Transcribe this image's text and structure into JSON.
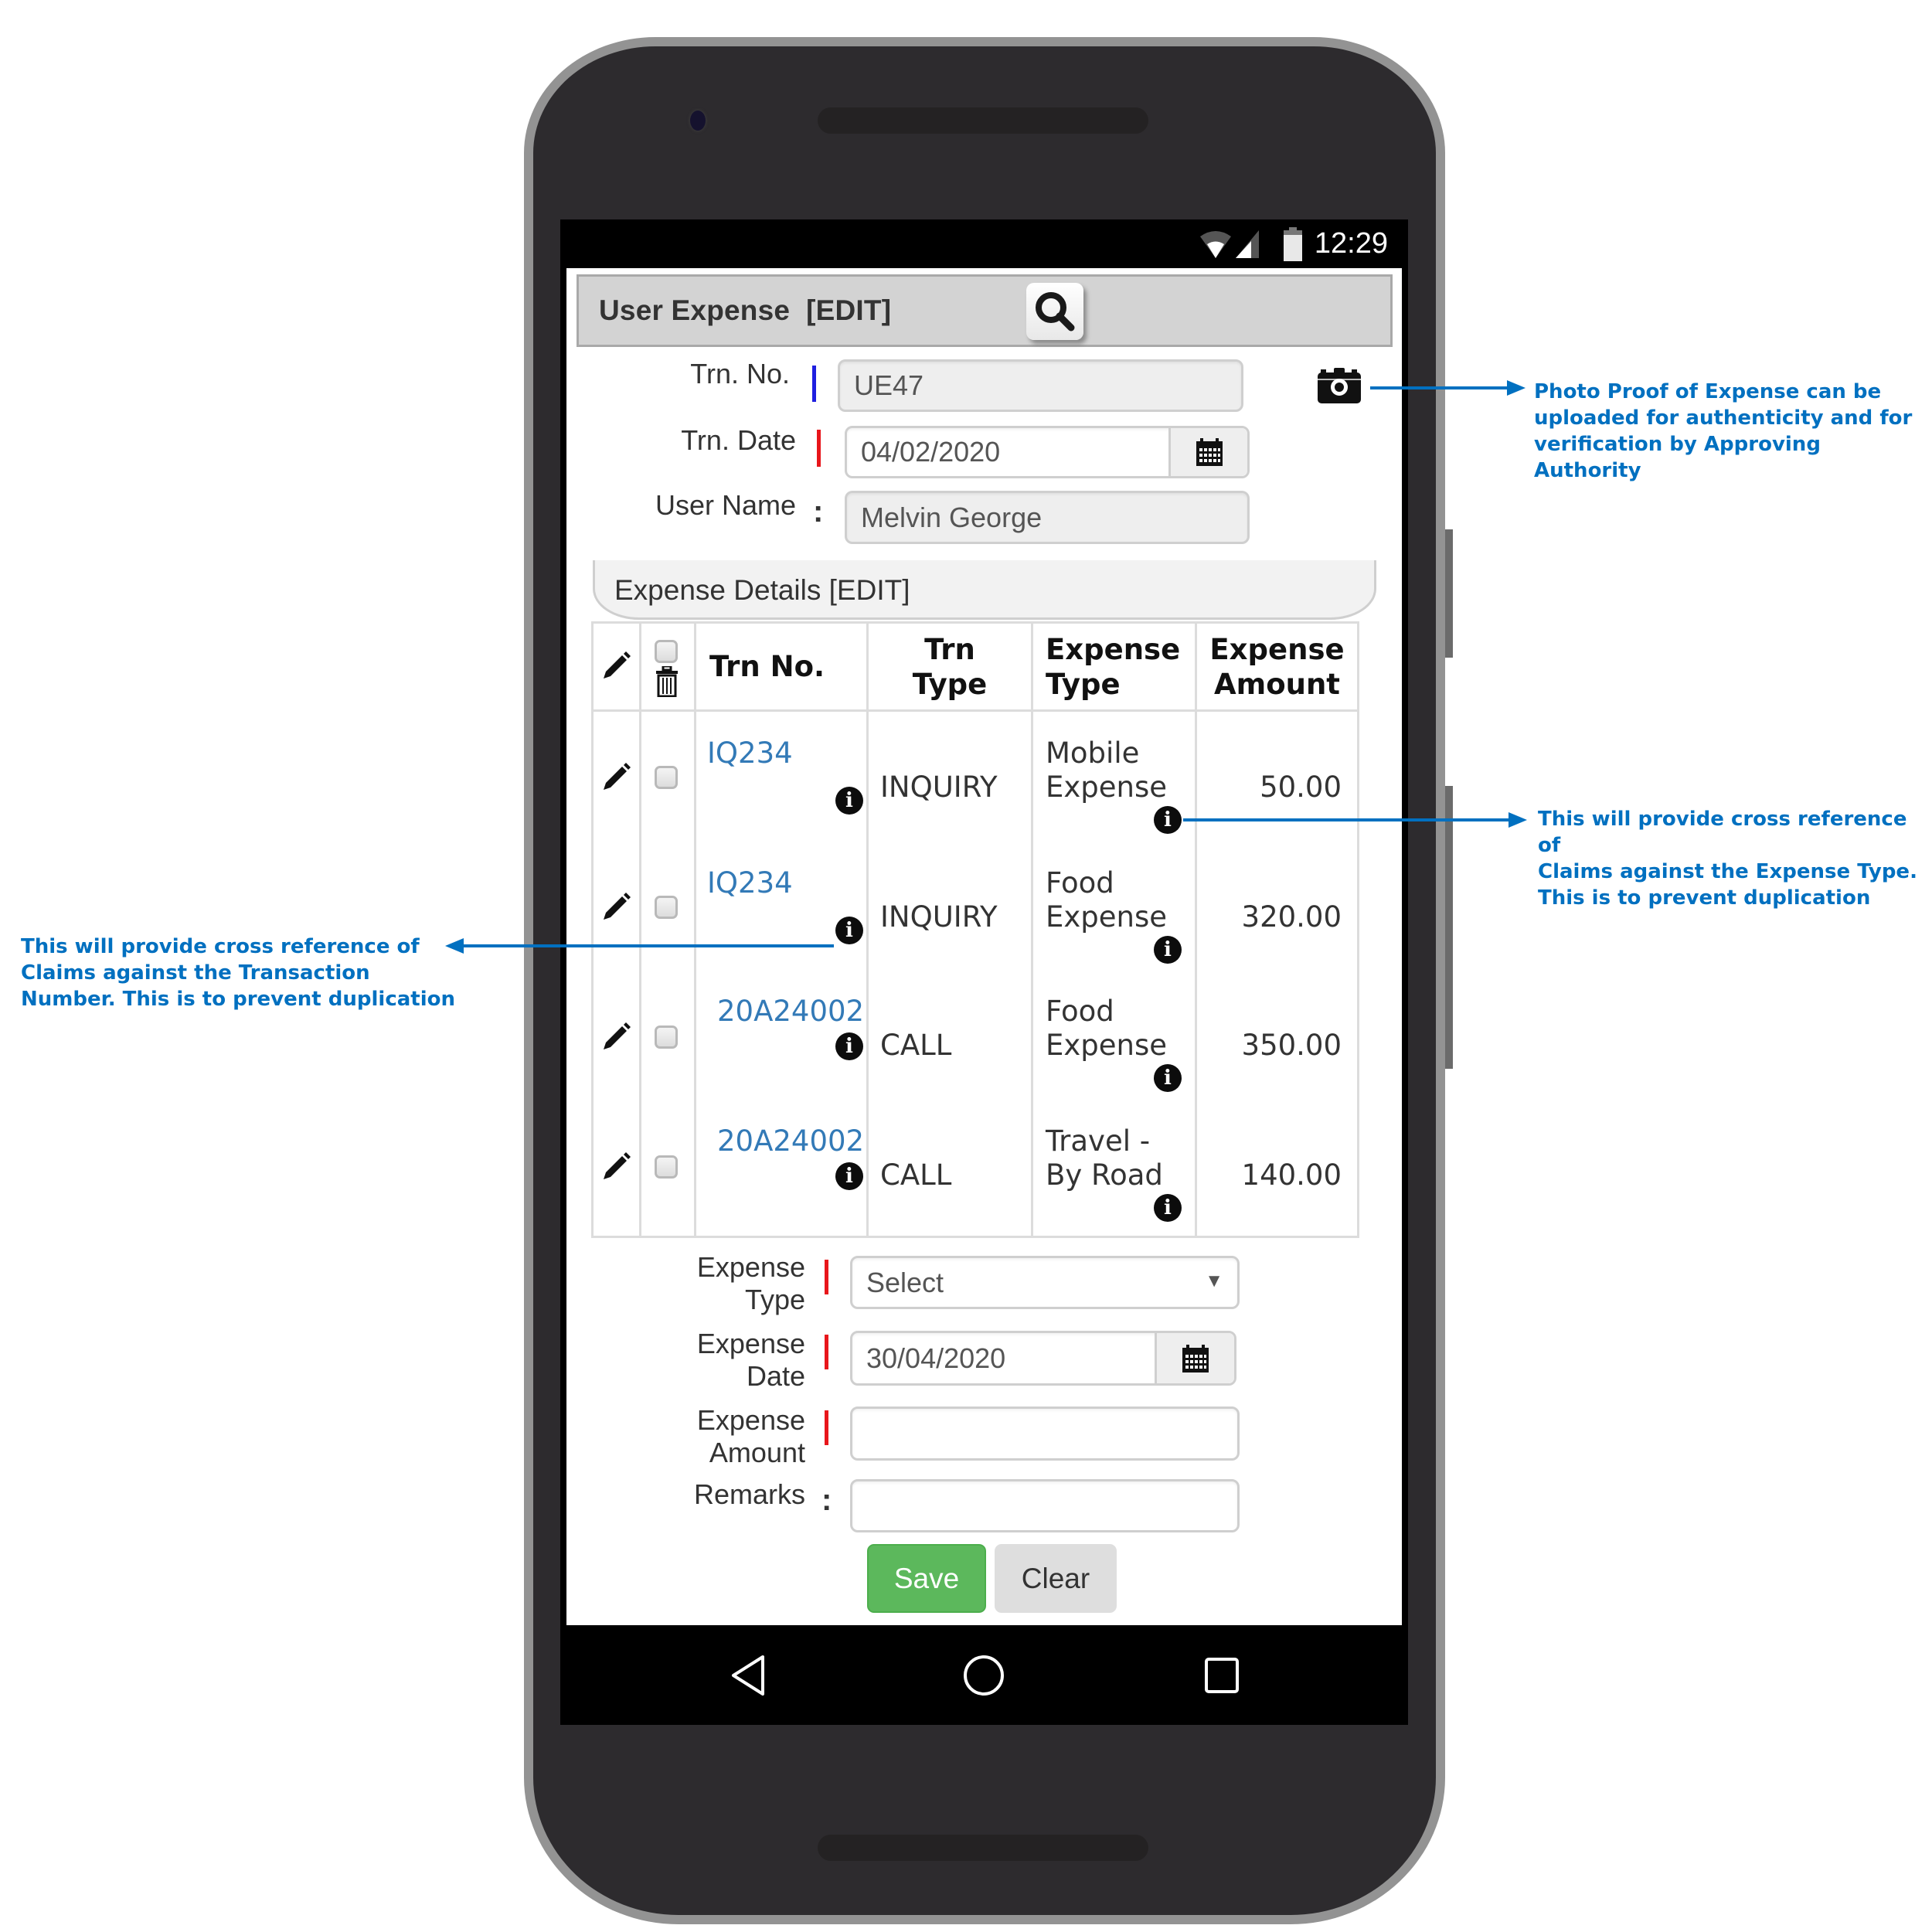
{
  "status_bar": {
    "time": "12:29",
    "icons": [
      "wifi-icon",
      "signal-icon",
      "battery-icon"
    ]
  },
  "header": {
    "title": "User Expense  [EDIT]",
    "search_icon": "search-icon"
  },
  "form": {
    "trn_no": {
      "label": "Trn. No.",
      "value": "UE47"
    },
    "trn_date": {
      "label": "Trn. Date",
      "value": "04/02/2020",
      "icon": "calendar-icon"
    },
    "user_name": {
      "label": "User Name",
      "separator": ":",
      "value": "Melvin George"
    },
    "camera_icon": "camera-icon"
  },
  "details": {
    "title": "Expense Details [EDIT]",
    "columns": {
      "edit": "edit-icon",
      "delete": "trash-icon",
      "trn_no": "Trn No.",
      "trn_type_1": "Trn",
      "trn_type_2": "Type",
      "expense_type_1": "Expense",
      "expense_type_2": "Type",
      "expense_amount_1": "Expense",
      "expense_amount_2": "Amount"
    },
    "rows": [
      {
        "trn_no": "IQ234",
        "trn_type": "INQUIRY",
        "expense_type_1": "Mobile",
        "expense_type_2": "Expense",
        "amount": "50.00",
        "checked": false
      },
      {
        "trn_no": "IQ234",
        "trn_type": "INQUIRY",
        "expense_type_1": "Food",
        "expense_type_2": "Expense",
        "amount": "320.00",
        "checked": false
      },
      {
        "trn_no": "20A24002",
        "trn_type": "CALL",
        "expense_type_1": "Food",
        "expense_type_2": "Expense",
        "amount": "350.00",
        "checked": false
      },
      {
        "trn_no": "20A24002",
        "trn_type": "CALL",
        "expense_type_1": "Travel -",
        "expense_type_2": "By Road",
        "amount": "140.00",
        "checked": false
      }
    ]
  },
  "entry": {
    "expense_type": {
      "label_1": "Expense",
      "label_2": "Type",
      "value": "Select"
    },
    "expense_date": {
      "label_1": "Expense",
      "label_2": "Date",
      "value": "30/04/2020"
    },
    "expense_amount": {
      "label_1": "Expense",
      "label_2": "Amount",
      "value": ""
    },
    "remarks": {
      "label": "Remarks",
      "separator": ":",
      "value": ""
    },
    "save_label": "Save",
    "clear_label": "Clear"
  },
  "annotations": {
    "camera_note": [
      "Photo Proof of Expense can be",
      "uploaded for authenticity and for",
      "verification by Approving Authority"
    ],
    "expense_type_note": [
      "This will provide cross reference of",
      "Claims against the Expense Type.",
      "This is to prevent duplication"
    ],
    "trn_no_note": [
      "This will provide cross reference of",
      "Claims against the Transaction",
      "Number. This is to prevent duplication"
    ]
  },
  "colors": {
    "accent_link": "#337ab7",
    "annotation": "#0070c0",
    "save_green": "#5cb85c",
    "required_marker": "#e8161b",
    "key_marker": "#1f1fe0"
  }
}
